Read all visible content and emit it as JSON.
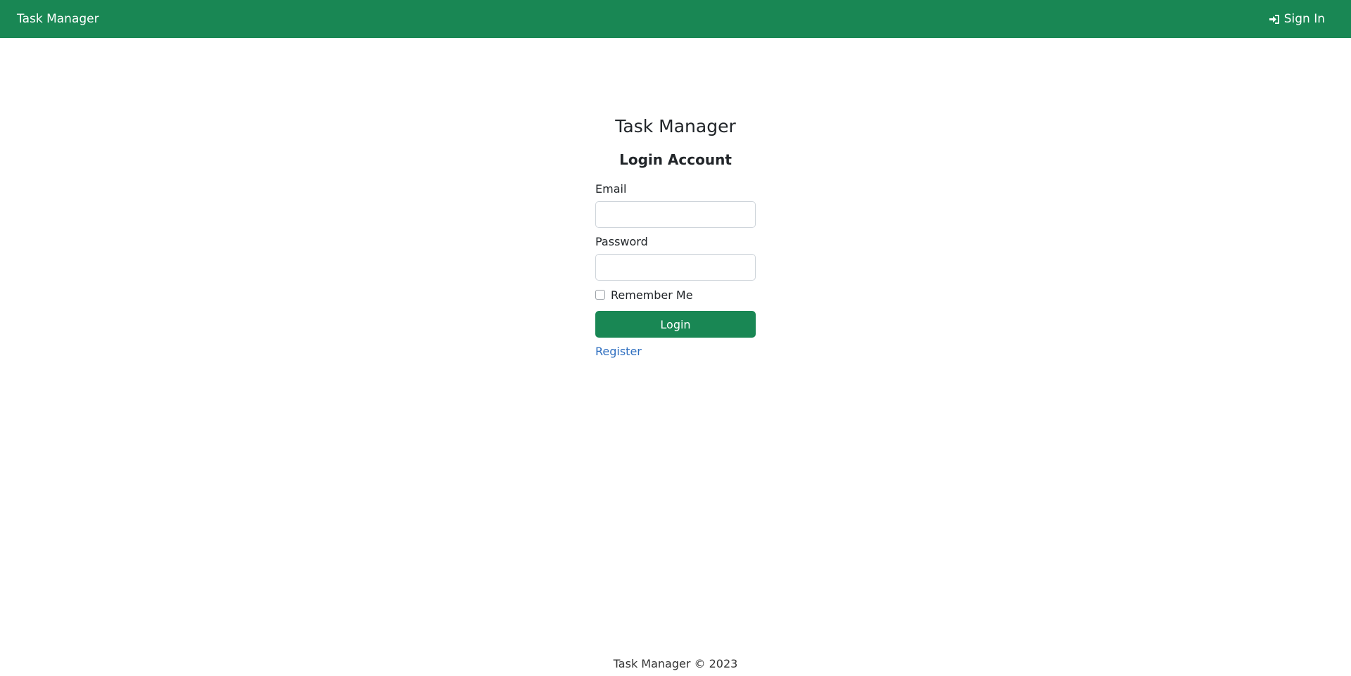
{
  "navbar": {
    "brand": "Task Manager",
    "signin_label": "Sign In",
    "signin_icon": "sign-in-icon",
    "background": "#198754"
  },
  "login": {
    "title": "Task Manager",
    "subtitle": "Login Account",
    "email_label": "Email",
    "email_value": "",
    "password_label": "Password",
    "password_value": "",
    "remember_label": "Remember Me",
    "remember_checked": false,
    "login_button": "Login",
    "register_link": "Register"
  },
  "footer": {
    "text": "Task Manager © 2023"
  },
  "colors": {
    "accent": "#198754",
    "link": "#2f6fc0"
  }
}
